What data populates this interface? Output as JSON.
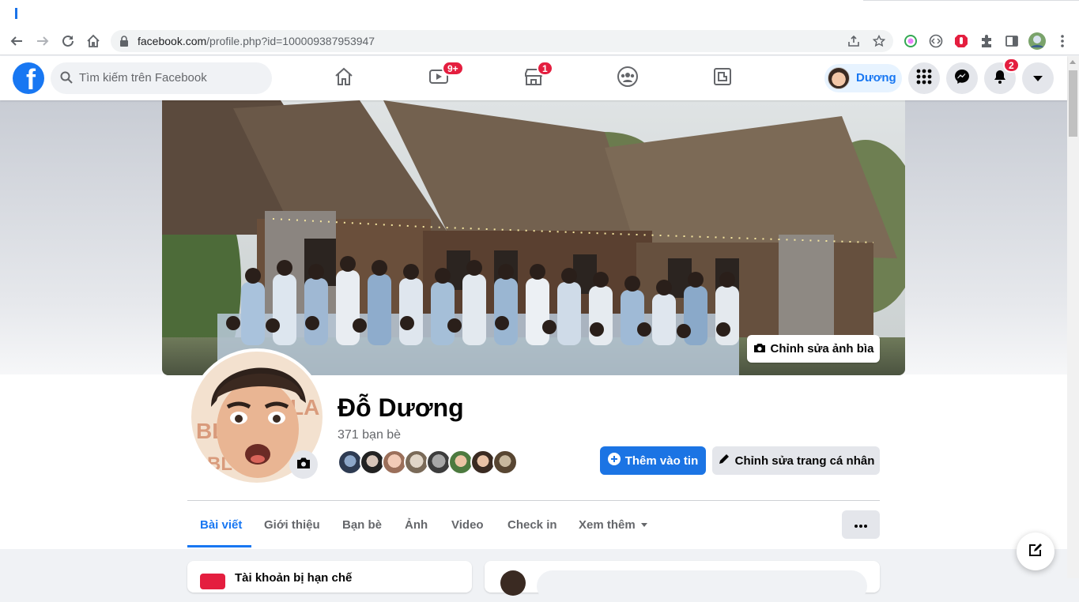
{
  "browser": {
    "url_host": "facebook.com",
    "url_path": "/profile.php?id=100009387953947"
  },
  "header": {
    "search_placeholder": "Tìm kiếm trên Facebook",
    "nav": [
      {
        "name": "home",
        "badge": ""
      },
      {
        "name": "watch",
        "badge": "9+"
      },
      {
        "name": "marketplace",
        "badge": "1"
      },
      {
        "name": "groups",
        "badge": ""
      },
      {
        "name": "gaming",
        "badge": ""
      }
    ],
    "profile_name": "Dương",
    "notifications_badge": "2"
  },
  "profile": {
    "edit_cover_label": "Chỉnh sửa ảnh bìa",
    "name": "Đỗ Dương",
    "friends_count": "371 bạn bè",
    "add_story_label": "Thêm vào tin",
    "edit_profile_label": "Chỉnh sửa trang cá nhân",
    "tabs": [
      "Bài viết",
      "Giới thiệu",
      "Bạn bè",
      "Ảnh",
      "Video",
      "Check in",
      "Xem thêm"
    ],
    "active_tab": "Bài viết"
  },
  "content": {
    "restricted_notice": "Tài khoản bị hạn chế"
  },
  "colors": {
    "brand": "#1877f2",
    "badge": "#e41e3f"
  }
}
